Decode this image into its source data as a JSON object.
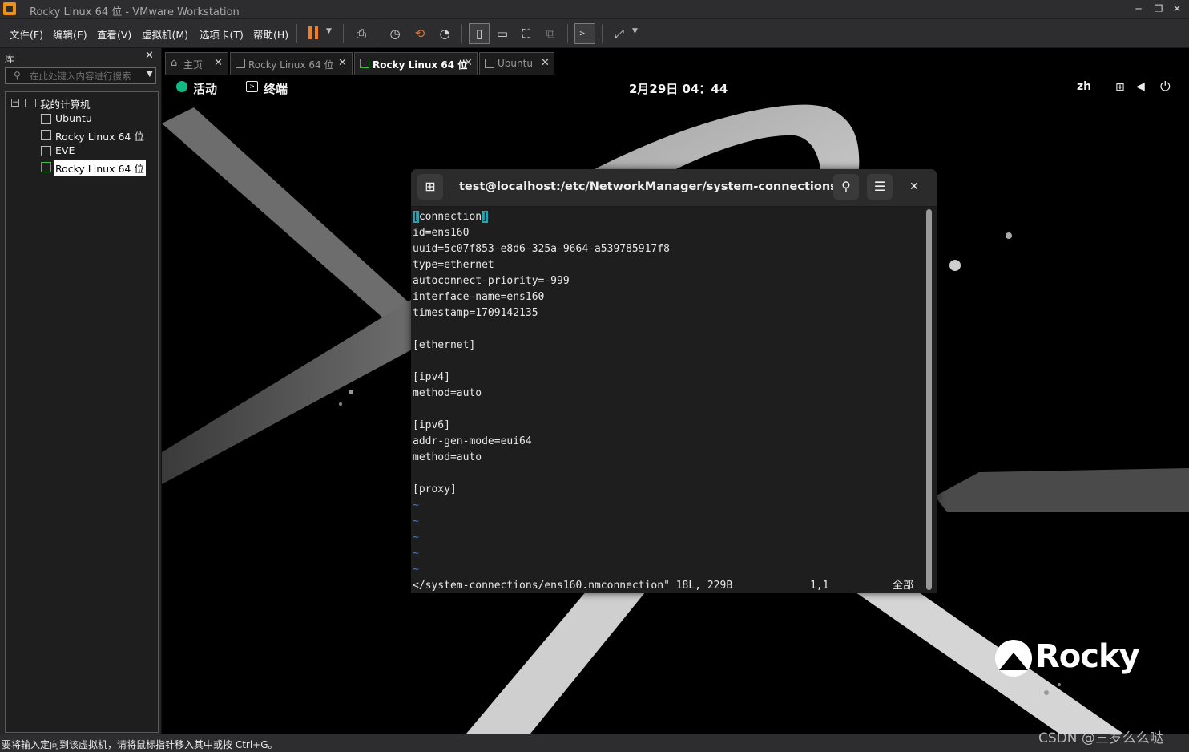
{
  "window": {
    "title": "Rocky Linux 64 位 - VMware Workstation"
  },
  "menu": [
    "文件(F)",
    "编辑(E)",
    "查看(V)",
    "虚拟机(M)",
    "选项卡(T)",
    "帮助(H)"
  ],
  "library": {
    "title": "库",
    "search_placeholder": "在此处键入内容进行搜索",
    "root": "我的计算机",
    "items": [
      "Ubuntu",
      "Rocky Linux 64 位",
      "EVE",
      "Rocky Linux 64 位"
    ],
    "selected_index": 3
  },
  "tabs": [
    {
      "label": "主页"
    },
    {
      "label": "Rocky Linux 64 位"
    },
    {
      "label": "Rocky Linux 64 位",
      "active": true
    },
    {
      "label": "Ubuntu"
    }
  ],
  "gnome": {
    "activities": "活动",
    "app": "终端",
    "clock": "2月29日  04：44",
    "lang": "zh"
  },
  "terminal": {
    "title": "test@localhost:/etc/NetworkManager/system-connections — /···",
    "lines": [
      "[connection]",
      "id=ens160",
      "uuid=5c07f853-e8d6-325a-9664-a539785917f8",
      "type=ethernet",
      "autoconnect-priority=-999",
      "interface-name=ens160",
      "timestamp=1709142135",
      "",
      "[ethernet]",
      "",
      "[ipv4]",
      "method=auto",
      "",
      "[ipv6]",
      "addr-gen-mode=eui64",
      "method=auto",
      "",
      "[proxy]",
      "~",
      "~",
      "~",
      "~",
      "~"
    ],
    "status_file": "</system-connections/ens160.nmconnection\" 18L, 229B",
    "status_pos": "1,1",
    "status_all": "全部"
  },
  "wallpaper": {
    "brand": "Rocky"
  },
  "statusbar": {
    "text": "要将输入定向到该虚拟机，请将鼠标指针移入其中或按 Ctrl+G。"
  },
  "watermark": "CSDN @三岁么么哒"
}
